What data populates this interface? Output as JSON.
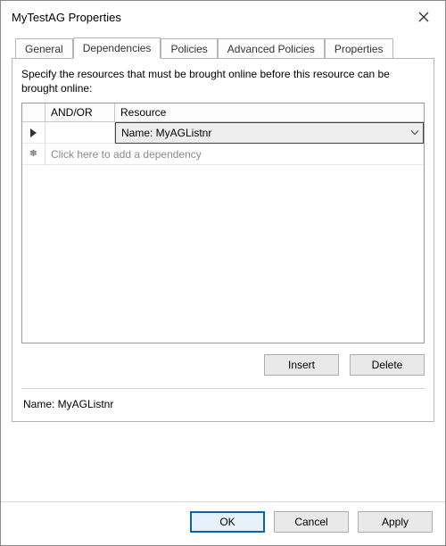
{
  "window": {
    "title": "MyTestAG Properties"
  },
  "tabs": {
    "general": "General",
    "dependencies": "Dependencies",
    "policies": "Policies",
    "advanced_policies": "Advanced Policies",
    "properties": "Properties",
    "active": "dependencies"
  },
  "panel": {
    "instruction": "Specify the resources that must be brought online before this resource can be brought online:",
    "headers": {
      "andor": "AND/OR",
      "resource": "Resource"
    },
    "rows": [
      {
        "andor": "",
        "resource": "Name: MyAGListnr",
        "selected": true
      }
    ],
    "placeholder": "Click here to add a dependency",
    "buttons": {
      "insert": "Insert",
      "delete": "Delete"
    },
    "detail_label": "Name: MyAGListnr"
  },
  "dialog_buttons": {
    "ok": "OK",
    "cancel": "Cancel",
    "apply": "Apply"
  }
}
